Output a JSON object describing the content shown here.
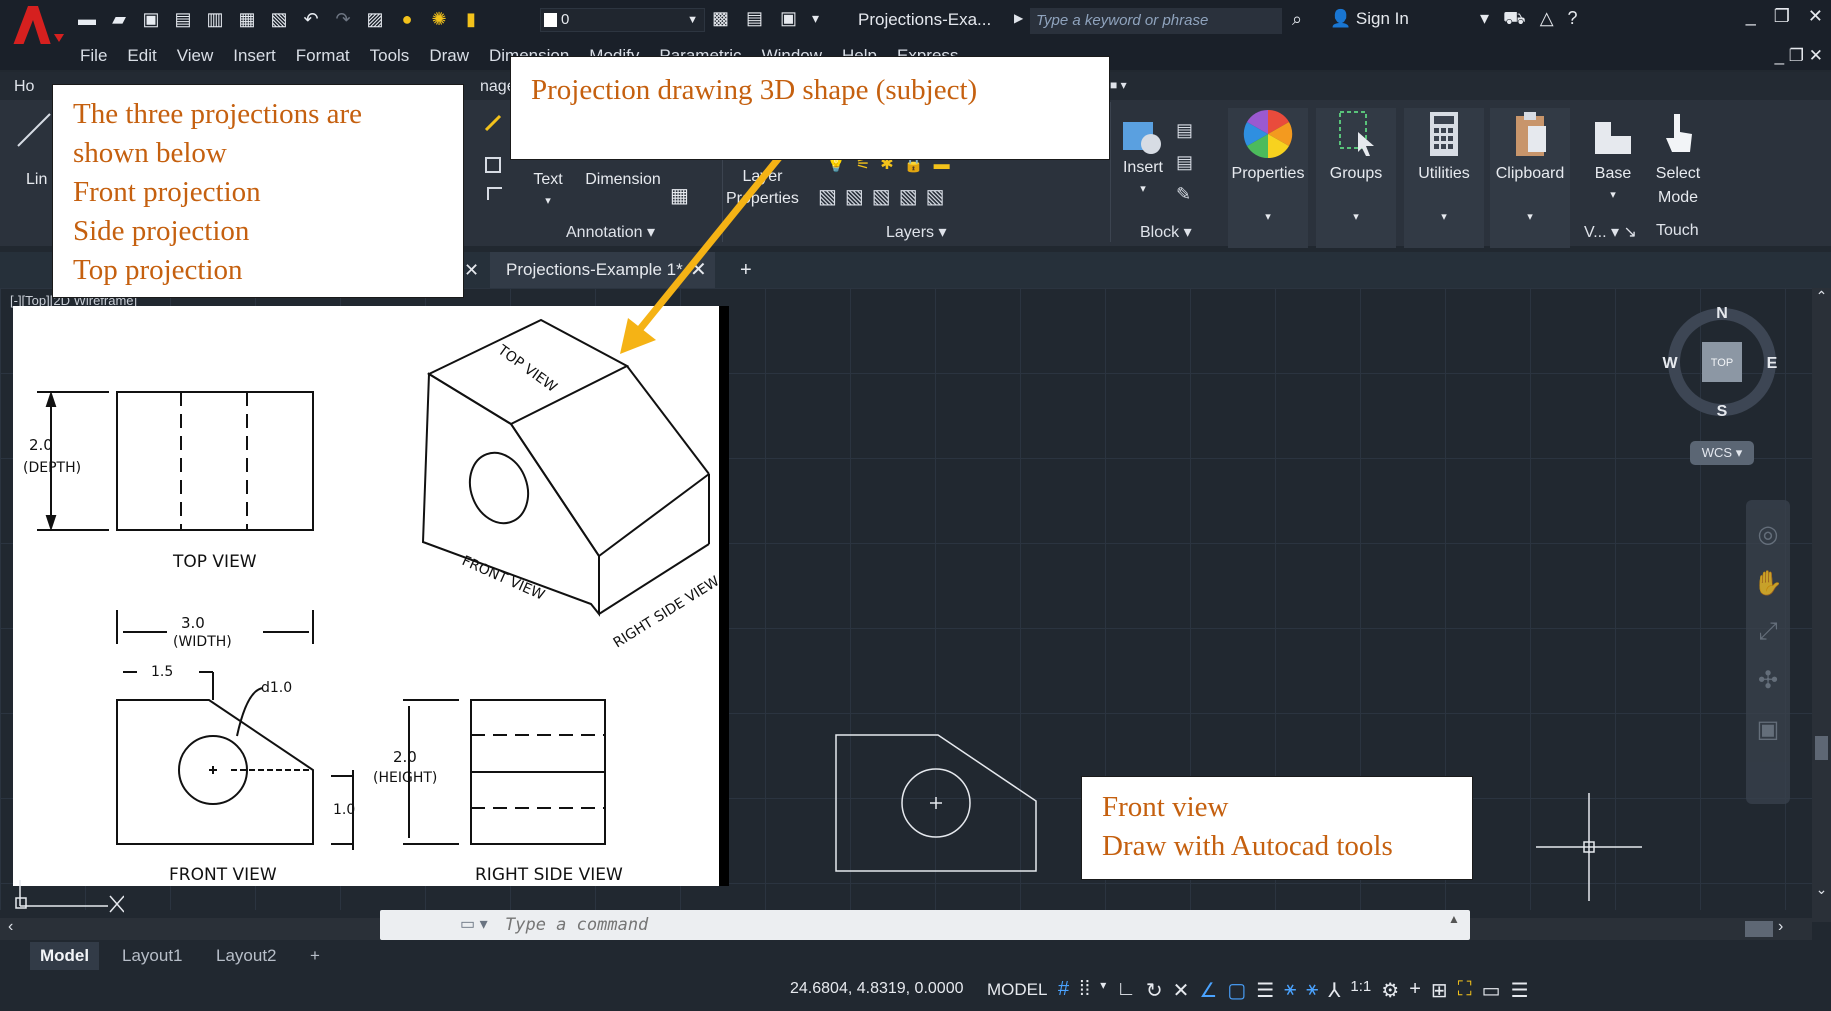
{
  "window": {
    "doc_title": "Projections-Exa...",
    "search_placeholder": "Type a keyword or phrase",
    "sign_in": "Sign In",
    "layer_value": "0"
  },
  "menu": [
    "File",
    "Edit",
    "View",
    "Insert",
    "Format",
    "Tools",
    "Draw",
    "Dimension",
    "Modify",
    "Parametric",
    "Window",
    "Help",
    "Express"
  ],
  "ribbon": {
    "tab_partial_home": "Ho",
    "tab_partial_manage": "nage",
    "left_label": "Lin",
    "annotation": {
      "text": "Text",
      "dimension": "Dimension",
      "title": "Annotation"
    },
    "layers": {
      "layer_properties_line1": "Layer",
      "layer_properties_line2": "Properties",
      "title": "Layers"
    },
    "block": {
      "insert": "Insert",
      "title": "Block"
    },
    "properties": "Properties",
    "groups": "Groups",
    "utilities": "Utilities",
    "clipboard": "Clipboard",
    "base": "Base",
    "view_title": "V...",
    "select_mode_1": "Select",
    "select_mode_2": "Mode",
    "touch": "Touch"
  },
  "doc_tabs": {
    "active": "Projections-Example 1*",
    "plus": "+"
  },
  "viewport_label": "[-][Top][2D Wireframe]",
  "viewcube": {
    "n": "N",
    "s": "S",
    "e": "E",
    "w": "W",
    "face": "TOP",
    "wcs": "WCS"
  },
  "reference": {
    "top_view": "TOP VIEW",
    "front_view": "FRONT VIEW",
    "right_side_view": "RIGHT SIDE VIEW",
    "iso_top": "TOP VIEW",
    "iso_front": "FRONT VIEW",
    "iso_right": "RIGHT SIDE VIEW",
    "depth_val": "2.0",
    "depth_lbl": "(DEPTH)",
    "width_val": "3.0",
    "width_lbl": "(WIDTH)",
    "half": "1.5",
    "dia": "d1.0",
    "height_val": "2.0",
    "height_lbl": "(HEIGHT)",
    "one": "1.0"
  },
  "notes": {
    "three": [
      "The three projections are",
      "shown below",
      "Front projection",
      "Side projection",
      "Top projection"
    ],
    "subject": "Projection drawing 3D shape (subject)",
    "front": [
      "Front view",
      "Draw with Autocad tools"
    ]
  },
  "command": {
    "placeholder": "Type a command"
  },
  "layout_tabs": [
    "Model",
    "Layout1",
    "Layout2",
    "+"
  ],
  "status": {
    "coords": "24.6804, 4.8319, 0.0000",
    "model": "MODEL",
    "scale": "1:1"
  },
  "colors": {
    "accent_orange": "#c5600f",
    "arrow": "#f5b315",
    "bg": "#212830"
  }
}
